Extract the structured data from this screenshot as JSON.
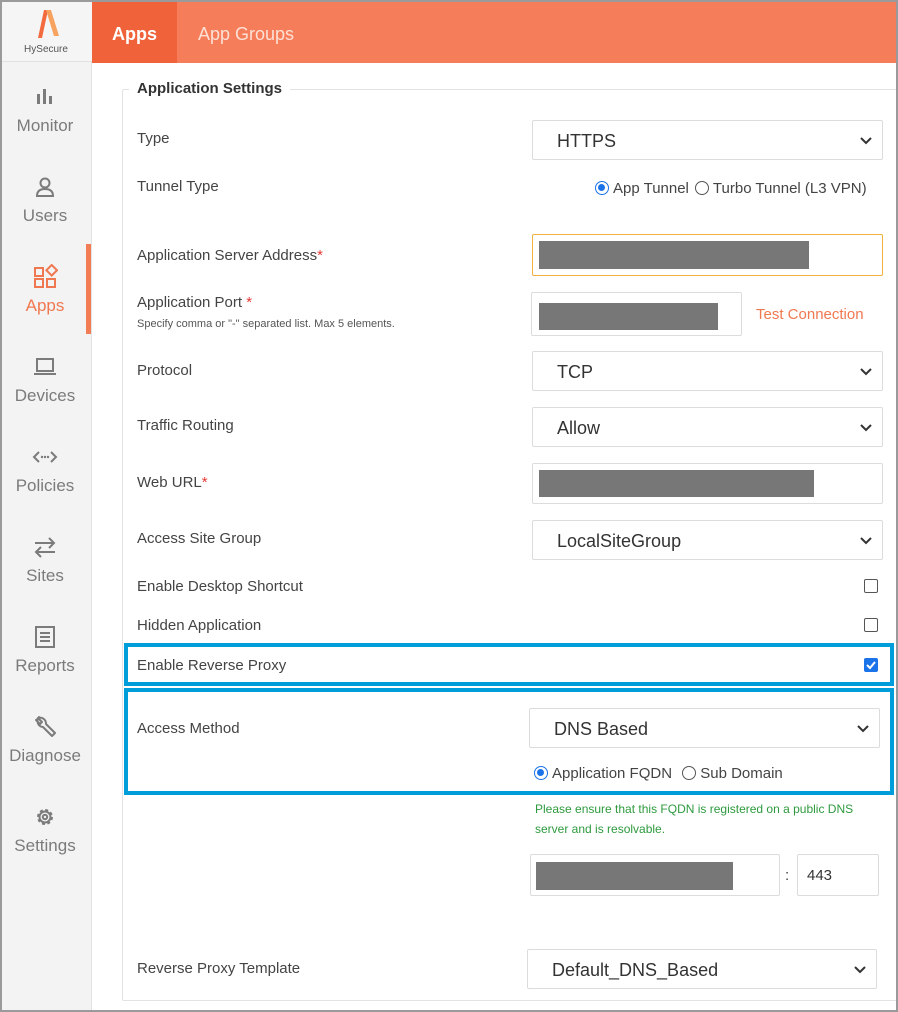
{
  "brand": {
    "name": "HySecure",
    "color": "#f57d5a"
  },
  "sidebar": {
    "items": [
      {
        "label": "Monitor",
        "icon": "bar-chart-icon"
      },
      {
        "label": "Users",
        "icon": "user-icon"
      },
      {
        "label": "Apps",
        "icon": "apps-grid-icon",
        "active": true
      },
      {
        "label": "Devices",
        "icon": "laptop-icon"
      },
      {
        "label": "Policies",
        "icon": "code-arrows-icon"
      },
      {
        "label": "Sites",
        "icon": "swap-arrows-icon"
      },
      {
        "label": "Reports",
        "icon": "report-icon"
      },
      {
        "label": "Diagnose",
        "icon": "wrench-icon"
      },
      {
        "label": "Settings",
        "icon": "gear-icon"
      }
    ]
  },
  "tabs": [
    {
      "label": "Apps",
      "active": true
    },
    {
      "label": "App Groups",
      "active": false
    }
  ],
  "form": {
    "section_title": "Application Settings",
    "type": {
      "label": "Type",
      "value": "HTTPS"
    },
    "tunnel_type": {
      "label": "Tunnel Type",
      "options": [
        "App Tunnel",
        "Turbo Tunnel (L3 VPN)"
      ],
      "selected": "App Tunnel"
    },
    "server_address": {
      "label": "Application Server Address",
      "required": "*"
    },
    "port": {
      "label": "Application Port",
      "required": "*",
      "hint": "Specify comma or \"-\" separated list. Max 5 elements.",
      "test_link": "Test Connection"
    },
    "protocol": {
      "label": "Protocol",
      "value": "TCP"
    },
    "traffic_routing": {
      "label": "Traffic Routing",
      "value": "Allow"
    },
    "web_url": {
      "label": "Web URL",
      "required": "*"
    },
    "access_site_group": {
      "label": "Access Site Group",
      "value": "LocalSiteGroup"
    },
    "desktop_shortcut": {
      "label": "Enable Desktop Shortcut",
      "checked": false
    },
    "hidden_app": {
      "label": "Hidden Application",
      "checked": false
    },
    "reverse_proxy": {
      "label": "Enable Reverse Proxy",
      "checked": true
    },
    "access_method": {
      "label": "Access Method",
      "value": "DNS Based",
      "options": [
        "Application FQDN",
        "Sub Domain"
      ],
      "selected": "Application FQDN"
    },
    "fqdn_note": "Please ensure that this FQDN is registered on a public DNS server and is resolvable.",
    "fqdn_port_separator": ":",
    "fqdn_port": "443",
    "reverse_proxy_template": {
      "label": "Reverse Proxy Template",
      "value": "Default_DNS_Based"
    }
  },
  "colors": {
    "accent": "#f57d5a",
    "active_tab": "#f0623a",
    "highlight": "#009ddb",
    "checkbox": "#1a73e8",
    "note_green": "#2e9a3e",
    "required": "#e53935"
  }
}
